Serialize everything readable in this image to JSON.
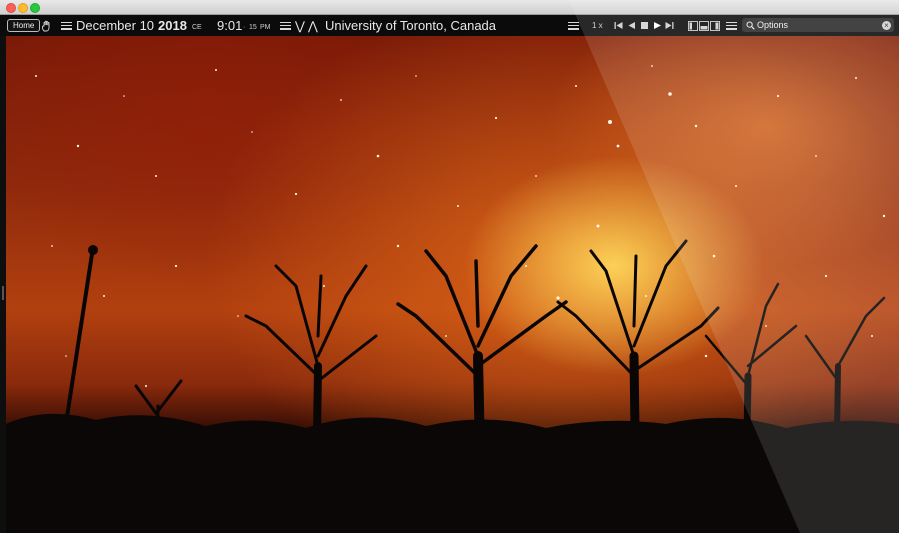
{
  "window": {
    "traffic_lights": [
      "close",
      "minimize",
      "maximize"
    ]
  },
  "toolbar": {
    "home_label": "Home",
    "date": "December 10",
    "year": "2018",
    "era": "CE",
    "time": "9:01",
    "seconds": "15",
    "ampm": "PM",
    "down_arrow": "⋁",
    "up_arrow": "⋀",
    "location": "University of Toronto, Canada",
    "speed": "1 x",
    "search_placeholder": "Options",
    "icons": {
      "hand": "hand-icon",
      "menu": "menu-icon",
      "first": "skip-back-icon",
      "back": "step-back-icon",
      "stop": "stop-icon",
      "play": "play-icon",
      "last": "skip-forward-icon",
      "layout": "layout-icon",
      "search": "search-icon",
      "clear": "clear-icon"
    }
  },
  "colors": {
    "toolbar_bg": "#0b0b0b",
    "sky_red": "#8f2a0c",
    "glow_yellow": "#ffd75a"
  }
}
